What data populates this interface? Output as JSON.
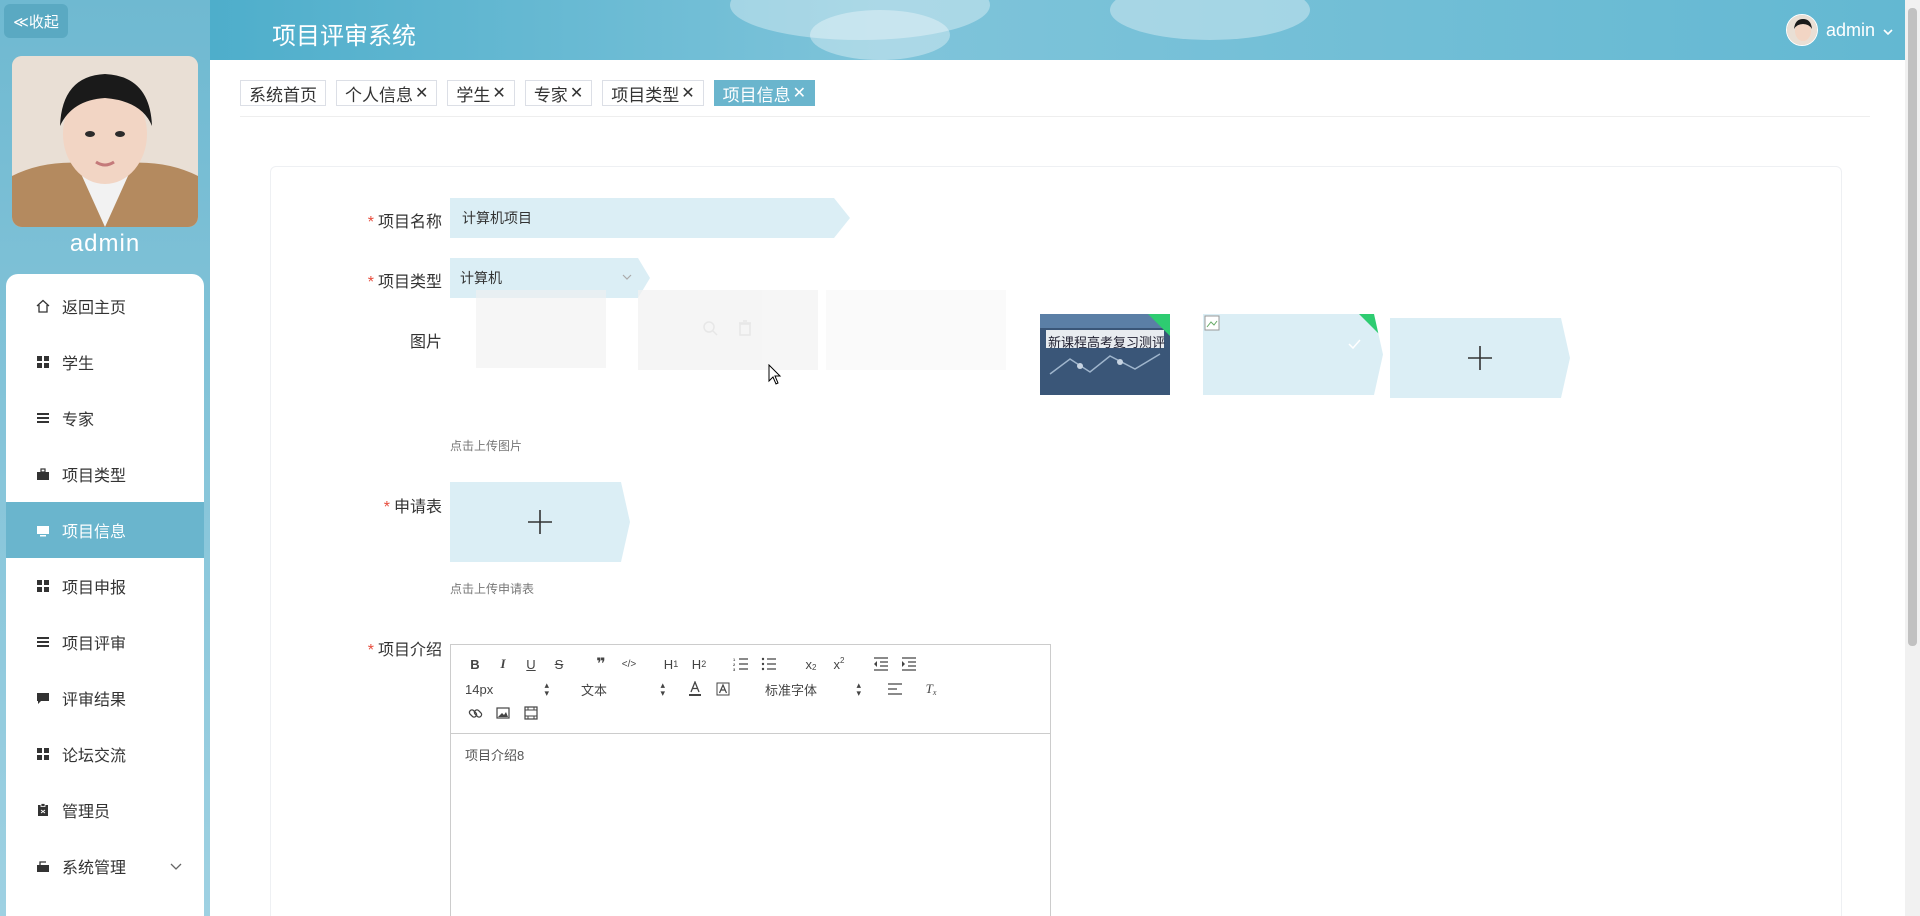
{
  "sidebar": {
    "collapse_label": "≪收起",
    "username": "admin",
    "items": [
      {
        "label": "返回主页",
        "icon": "home-icon"
      },
      {
        "label": "学生",
        "icon": "grid-icon"
      },
      {
        "label": "专家",
        "icon": "list-icon"
      },
      {
        "label": "项目类型",
        "icon": "briefcase-icon"
      },
      {
        "label": "项目信息",
        "icon": "monitor-icon"
      },
      {
        "label": "项目申报",
        "icon": "grid-icon"
      },
      {
        "label": "项目评审",
        "icon": "list-icon"
      },
      {
        "label": "评审结果",
        "icon": "comment-icon"
      },
      {
        "label": "论坛交流",
        "icon": "grid-icon"
      },
      {
        "label": "管理员",
        "icon": "clipboard-icon"
      },
      {
        "label": "系统管理",
        "icon": "settings-icon"
      }
    ]
  },
  "header": {
    "title": "项目评审系统",
    "username": "admin"
  },
  "tabs": [
    {
      "label": "系统首页",
      "closable": false
    },
    {
      "label": "个人信息",
      "closable": true
    },
    {
      "label": "学生",
      "closable": true
    },
    {
      "label": "专家",
      "closable": true
    },
    {
      "label": "项目类型",
      "closable": true
    },
    {
      "label": "项目信息",
      "closable": true
    }
  ],
  "form": {
    "name_label": "项目名称",
    "name_value": "计算机项目",
    "type_label": "项目类型",
    "type_value": "计算机",
    "image_label": "图片",
    "image_hint": "点击上传图片",
    "application_label": "申请表",
    "application_hint": "点击上传申请表",
    "intro_label": "项目介绍",
    "intro_value": "项目介绍8",
    "uploaded_image_caption": "新课程高考复习测评"
  },
  "editor": {
    "font_size": "14px",
    "text_style": "文本",
    "font_family": "标准字体"
  },
  "colors": {
    "accent": "#6ab5cd",
    "input_bg": "#dbeef5",
    "required": "#e74c3c",
    "success_corner": "#2ecc71"
  }
}
